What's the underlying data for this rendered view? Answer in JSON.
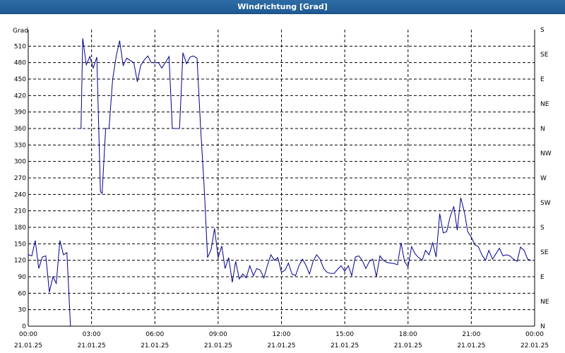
{
  "window": {
    "title": "Windrichtung [Grad]"
  },
  "colors": {
    "title_bar": "#1f5a93",
    "line": "#00008b",
    "grid": "#000000"
  },
  "chart_data": {
    "type": "line",
    "title": "Windrichtung [Grad]",
    "ylabel": "Grad",
    "ylim": [
      0,
      540
    ],
    "yticks": [
      0,
      30,
      60,
      90,
      120,
      150,
      180,
      210,
      240,
      270,
      300,
      330,
      360,
      390,
      420,
      450,
      480,
      510
    ],
    "y2ticks": [
      {
        "value": 0,
        "label": "N"
      },
      {
        "value": 45,
        "label": "NE"
      },
      {
        "value": 90,
        "label": "E"
      },
      {
        "value": 135,
        "label": "SE"
      },
      {
        "value": 180,
        "label": "S"
      },
      {
        "value": 225,
        "label": "SW"
      },
      {
        "value": 270,
        "label": "W"
      },
      {
        "value": 315,
        "label": "NW"
      },
      {
        "value": 360,
        "label": "N"
      },
      {
        "value": 405,
        "label": "NE"
      },
      {
        "value": 450,
        "label": "E"
      },
      {
        "value": 495,
        "label": "SE"
      },
      {
        "value": 540,
        "label": "S"
      }
    ],
    "xlim_hours": [
      0,
      24
    ],
    "xticks": [
      {
        "hour": 0,
        "time": "00:00",
        "date": "21.01.25"
      },
      {
        "hour": 3,
        "time": "03:00",
        "date": "21.01.25"
      },
      {
        "hour": 6,
        "time": "06:00",
        "date": "21.01.25"
      },
      {
        "hour": 9,
        "time": "09:00",
        "date": "21.01.25"
      },
      {
        "hour": 12,
        "time": "12:00",
        "date": "21.01.25"
      },
      {
        "hour": 15,
        "time": "15:00",
        "date": "21.01.25"
      },
      {
        "hour": 18,
        "time": "18:00",
        "date": "21.01.25"
      },
      {
        "hour": 21,
        "time": "21:00",
        "date": "21.01.25"
      },
      {
        "hour": 24,
        "time": "00:00",
        "date": "22.01.25"
      }
    ],
    "grid": true,
    "series": [
      {
        "x": [
          0.0,
          0.17,
          0.33,
          0.5,
          0.67,
          0.83,
          1.0,
          1.17,
          1.33,
          1.5,
          1.67,
          1.83,
          2.0
        ],
        "y": [
          130,
          128,
          156,
          105,
          126,
          128,
          62,
          90,
          78,
          156,
          130,
          134,
          0
        ]
      },
      {
        "x": [
          2.33,
          2.5,
          2.58,
          2.75,
          2.92,
          3.08,
          3.25,
          3.42,
          3.5,
          3.67,
          3.83,
          4.0,
          4.17,
          4.33,
          4.5,
          4.67,
          4.83,
          5.0,
          5.17,
          5.33,
          5.5,
          5.67,
          5.83,
          6.0,
          6.17,
          6.33,
          6.5,
          6.67,
          6.83,
          7.0,
          7.17,
          7.33,
          7.5,
          7.67,
          7.83,
          8.0,
          8.17,
          8.33,
          8.5,
          8.67,
          8.83,
          9.0,
          9.17,
          9.33,
          9.5,
          9.67,
          9.83,
          10.0,
          10.17,
          10.33,
          10.5,
          10.67,
          10.83,
          11.0,
          11.17,
          11.33,
          11.5,
          11.67,
          11.83,
          12.0,
          12.17,
          12.33,
          12.5,
          12.67,
          12.83,
          13.0,
          13.17,
          13.33,
          13.5,
          13.67,
          13.83,
          14.0,
          14.17,
          14.33,
          14.5,
          14.67,
          14.83,
          15.0,
          15.17,
          15.33,
          15.5,
          15.67,
          15.83,
          16.0,
          16.17,
          16.33,
          16.5,
          16.67,
          16.83,
          17.0,
          17.17,
          17.33,
          17.5,
          17.67,
          17.83,
          18.0,
          18.17,
          18.33,
          18.5,
          18.67,
          18.83,
          19.0,
          19.17,
          19.33,
          19.5,
          19.67,
          19.83,
          20.0,
          20.17,
          20.33,
          20.5,
          20.67,
          20.83,
          21.0,
          21.17,
          21.33,
          21.5,
          21.67,
          21.83,
          22.0,
          22.17,
          22.33,
          22.5,
          22.67,
          22.83,
          23.0,
          23.17,
          23.33,
          23.5,
          23.67,
          23.83
        ],
        "y": [
          360,
          360,
          524,
          476,
          491,
          470,
          490,
          245,
          242,
          360,
          360,
          450,
          492,
          520,
          475,
          488,
          484,
          480,
          445,
          475,
          485,
          492,
          480,
          480,
          480,
          470,
          480,
          491,
          360,
          360,
          360,
          498,
          478,
          490,
          492,
          488,
          360,
          258,
          125,
          140,
          178,
          125,
          146,
          105,
          125,
          80,
          118,
          86,
          95,
          88,
          110,
          92,
          105,
          102,
          88,
          110,
          130,
          120,
          125,
          98,
          102,
          115,
          95,
          92,
          110,
          122,
          110,
          95,
          118,
          130,
          122,
          105,
          98,
          96,
          96,
          104,
          110,
          100,
          110,
          92,
          126,
          128,
          120,
          105,
          118,
          122,
          90,
          128,
          120,
          116,
          115,
          114,
          112,
          152,
          118,
          108,
          145,
          132,
          125,
          120,
          138,
          130,
          152,
          126,
          205,
          170,
          172,
          200,
          218,
          175,
          234,
          208,
          172,
          162,
          148,
          145,
          130,
          120,
          138,
          122,
          132,
          142,
          128,
          130,
          128,
          122,
          118,
          144,
          138,
          122,
          120
        ]
      }
    ]
  }
}
